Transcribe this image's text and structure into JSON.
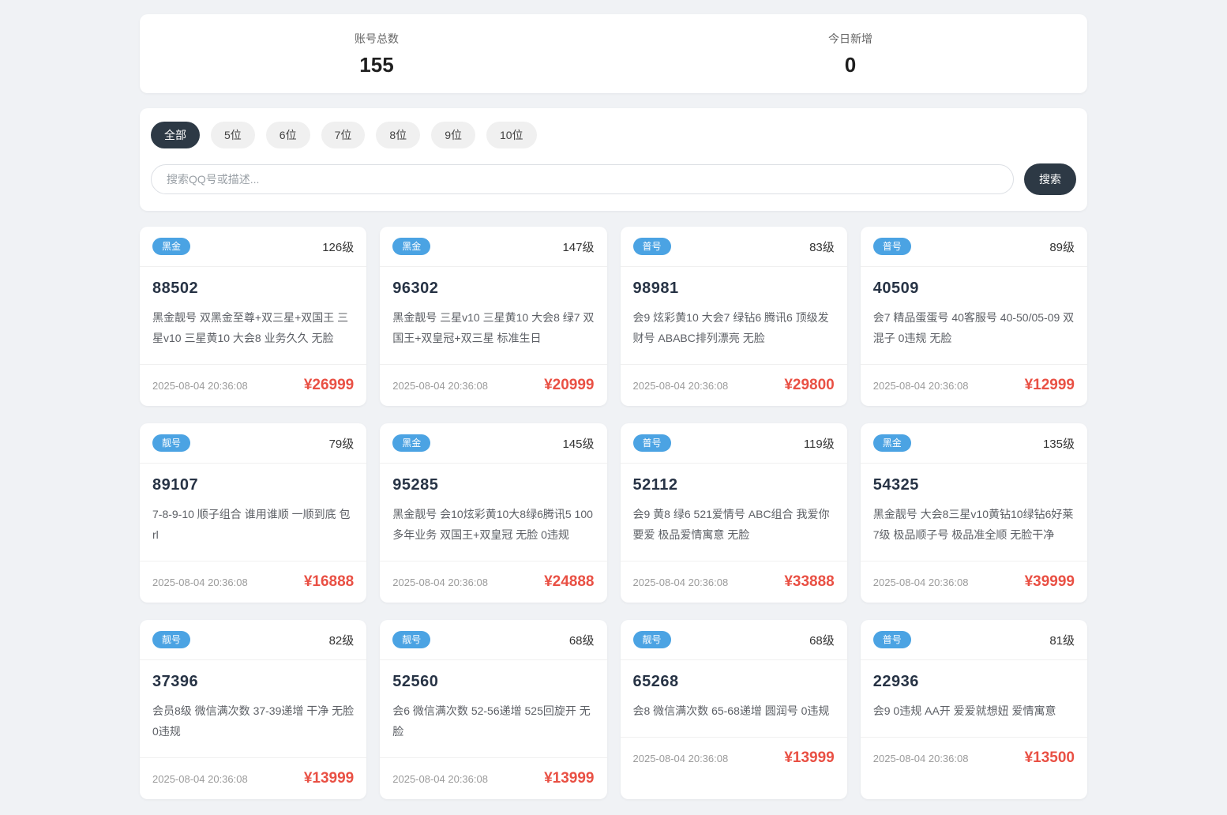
{
  "colors": {
    "page_background": "#f0f2f5",
    "accent_dark": "#2d3945",
    "badge_blue": "#4ba3e3",
    "price_red": "#e95044"
  },
  "stats": {
    "items": [
      {
        "label": "账号总数",
        "value": "155"
      },
      {
        "label": "今日新增",
        "value": "0"
      }
    ]
  },
  "filters": {
    "tabs": [
      {
        "label": "全部",
        "active": true
      },
      {
        "label": "5位",
        "active": false
      },
      {
        "label": "6位",
        "active": false
      },
      {
        "label": "7位",
        "active": false
      },
      {
        "label": "8位",
        "active": false
      },
      {
        "label": "9位",
        "active": false
      },
      {
        "label": "10位",
        "active": false
      }
    ]
  },
  "search": {
    "placeholder": "搜索QQ号或描述...",
    "button_label": "搜索"
  },
  "cards": [
    {
      "badge": "黑金",
      "level": "126级",
      "number": "88502",
      "desc": "黑金靓号 双黑金至尊+双三星+双国王 三星v10 三星黄10 大会8 业务久久 无脸",
      "date": "2025-08-04 20:36:08",
      "price": "¥26999"
    },
    {
      "badge": "黑金",
      "level": "147级",
      "number": "96302",
      "desc": "黑金靓号 三星v10 三星黄10 大会8 绿7 双国王+双皇冠+双三星 标准生日",
      "date": "2025-08-04 20:36:08",
      "price": "¥20999"
    },
    {
      "badge": "普号",
      "level": "83级",
      "number": "98981",
      "desc": "会9 炫彩黄10 大会7 绿钻6 腾讯6 顶级发财号 ABABC排列漂亮 无脸",
      "date": "2025-08-04 20:36:08",
      "price": "¥29800"
    },
    {
      "badge": "普号",
      "level": "89级",
      "number": "40509",
      "desc": "会7 精品蛋蛋号 40客服号 40-50/05-09 双混子 0违规 无脸",
      "date": "2025-08-04 20:36:08",
      "price": "¥12999"
    },
    {
      "badge": "靓号",
      "level": "79级",
      "number": "89107",
      "desc": "7-8-9-10 顺子组合 谁用谁顺 一顺到底 包rl",
      "date": "2025-08-04 20:36:08",
      "price": "¥16888"
    },
    {
      "badge": "黑金",
      "level": "145级",
      "number": "95285",
      "desc": "黑金靓号 会10炫彩黄10大8绿6腾讯5 100多年业务 双国王+双皇冠 无脸 0违规",
      "date": "2025-08-04 20:36:08",
      "price": "¥24888"
    },
    {
      "badge": "普号",
      "level": "119级",
      "number": "52112",
      "desc": "会9 黄8 绿6 521爱情号 ABC组合 我爱你要爱 极品爱情寓意 无脸",
      "date": "2025-08-04 20:36:08",
      "price": "¥33888"
    },
    {
      "badge": "黑金",
      "level": "135级",
      "number": "54325",
      "desc": "黑金靓号 大会8三星v10黄钻10绿钻6好莱7级 极品顺子号 极品准全顺 无脸干净",
      "date": "2025-08-04 20:36:08",
      "price": "¥39999"
    },
    {
      "badge": "靓号",
      "level": "82级",
      "number": "37396",
      "desc": "会员8级 微信满次数 37-39递增 干净 无脸 0违规",
      "date": "2025-08-04 20:36:08",
      "price": "¥13999"
    },
    {
      "badge": "靓号",
      "level": "68级",
      "number": "52560",
      "desc": "会6 微信满次数 52-56递增 525回旋开 无脸",
      "date": "2025-08-04 20:36:08",
      "price": "¥13999"
    },
    {
      "badge": "靓号",
      "level": "68级",
      "number": "65268",
      "desc": "会8 微信满次数 65-68递增 圆润号 0违规",
      "date": "2025-08-04 20:36:08",
      "price": "¥13999"
    },
    {
      "badge": "普号",
      "level": "81级",
      "number": "22936",
      "desc": "会9 0违规 AA开 爱爱就想妞 爱情寓意",
      "date": "2025-08-04 20:36:08",
      "price": "¥13500"
    }
  ]
}
